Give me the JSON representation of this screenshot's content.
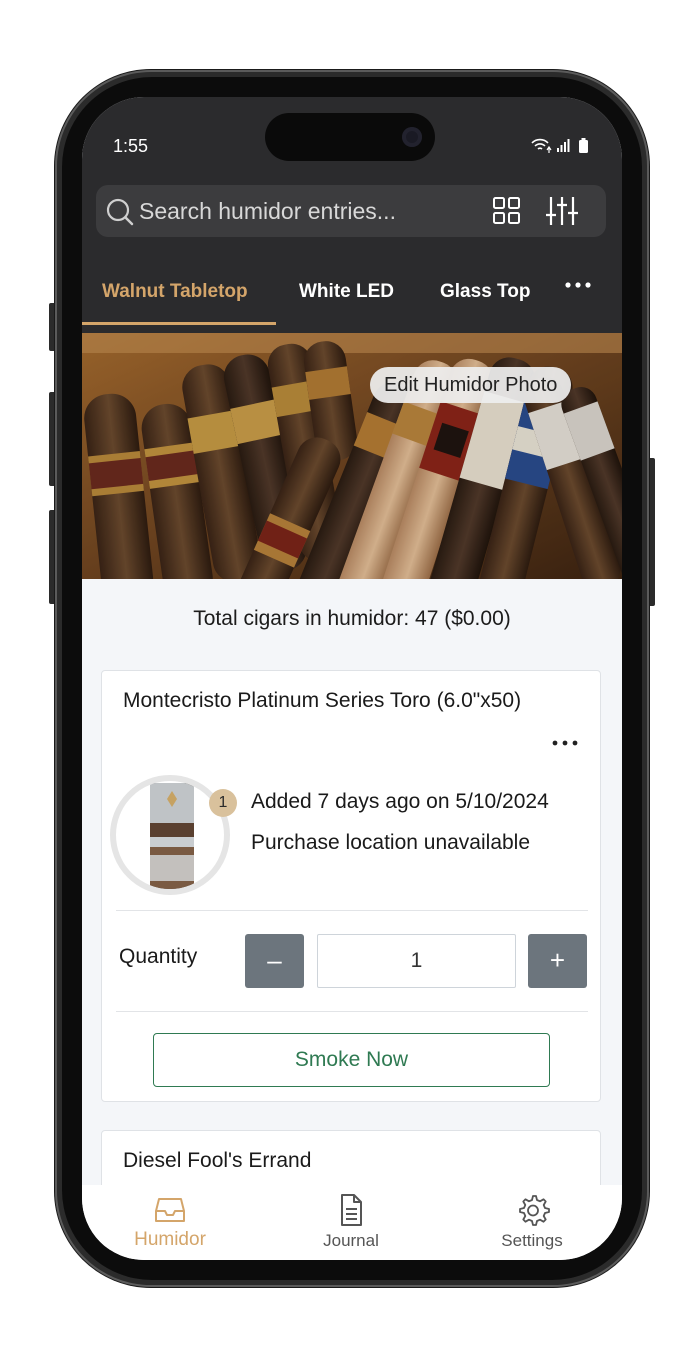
{
  "status_bar": {
    "time": "1:55"
  },
  "search": {
    "placeholder": "Search humidor entries..."
  },
  "tabs": [
    {
      "label": "Walnut Tabletop",
      "active": true
    },
    {
      "label": "White LED",
      "active": false
    },
    {
      "label": "Glass Top",
      "active": false
    }
  ],
  "hero": {
    "edit_label": "Edit Humidor Photo"
  },
  "summary": {
    "total_text": "Total cigars in humidor: 47 ($0.00)"
  },
  "entries": [
    {
      "title": "Montecristo Platinum Series Toro (6.0\"x50)",
      "count_badge": "1",
      "added_text": "Added 7 days ago on 5/10/2024",
      "location_text": "Purchase location unavailable",
      "quantity_label": "Quantity",
      "quantity_value": "1",
      "minus_label": "–",
      "plus_label": "+",
      "smoke_label": "Smoke Now"
    },
    {
      "title": "Diesel Fool's Errand"
    }
  ],
  "bottom_nav": [
    {
      "label": "Humidor",
      "icon": "inbox-icon",
      "active": true
    },
    {
      "label": "Journal",
      "icon": "document-icon",
      "active": false
    },
    {
      "label": "Settings",
      "icon": "gear-icon",
      "active": false
    }
  ],
  "colors": {
    "accent": "#d4a56a",
    "header_bg": "#2b2b2d",
    "smoke_green": "#2f7a52",
    "qty_button": "#6c757d"
  }
}
